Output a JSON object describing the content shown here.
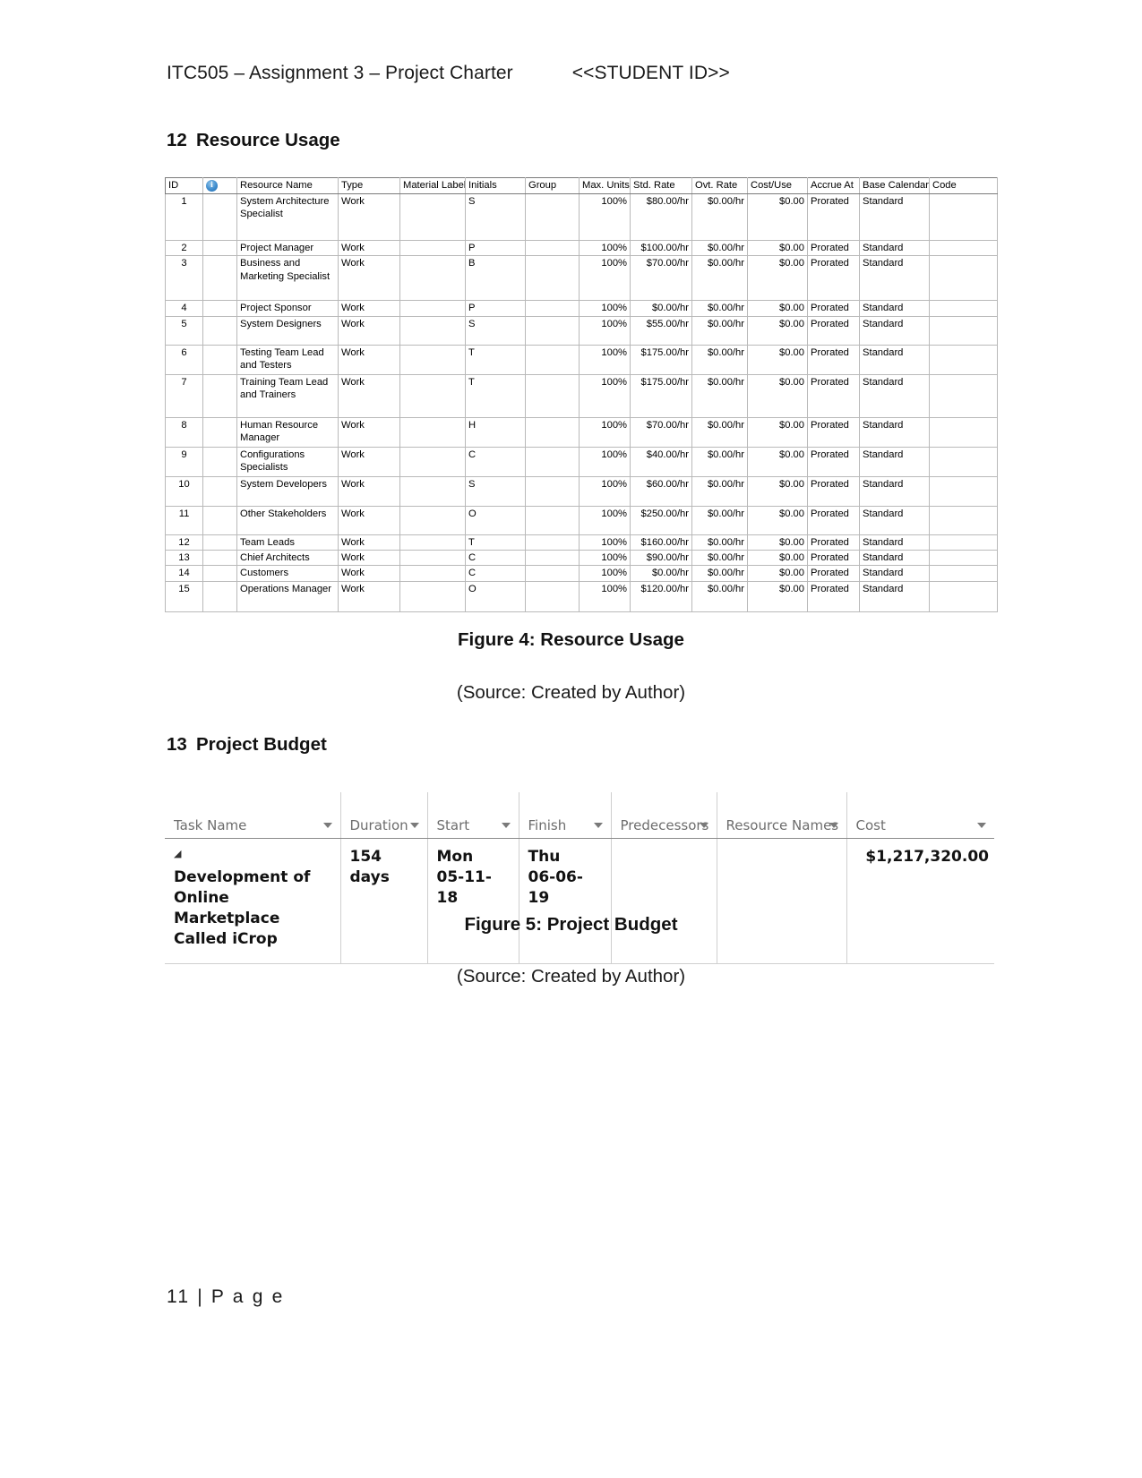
{
  "document": {
    "header_title": "ITC505 – Assignment 3 – Project Charter",
    "header_student_id": "<<STUDENT ID>>",
    "footer": "11 | P a g e"
  },
  "sections": [
    {
      "number": "12",
      "title": "Resource Usage"
    },
    {
      "number": "13",
      "title": "Project Budget"
    }
  ],
  "resource_usage": {
    "headers": {
      "id": "ID",
      "indicator": "i",
      "resource_name": "Resource Name",
      "type": "Type",
      "material_label": "Material Label",
      "initials": "Initials",
      "group": "Group",
      "max_units": "Max. Units",
      "std_rate": "Std. Rate",
      "ovt_rate": "Ovt. Rate",
      "cost_use": "Cost/Use",
      "accrue_at": "Accrue At",
      "base_calendar": "Base Calendar",
      "code": "Code"
    },
    "rows": [
      {
        "id": "1",
        "name": "System Architecture Specialist",
        "type": "Work",
        "material_label": "",
        "initials": "S",
        "group": "",
        "max_units": "100%",
        "std_rate": "$80.00/hr",
        "ovt_rate": "$0.00/hr",
        "cost_use": "$0.00",
        "accrue_at": "Prorated",
        "base_calendar": "Standard",
        "code": ""
      },
      {
        "id": "2",
        "name": "Project Manager",
        "type": "Work",
        "material_label": "",
        "initials": "P",
        "group": "",
        "max_units": "100%",
        "std_rate": "$100.00/hr",
        "ovt_rate": "$0.00/hr",
        "cost_use": "$0.00",
        "accrue_at": "Prorated",
        "base_calendar": "Standard",
        "code": ""
      },
      {
        "id": "3",
        "name": "Business and Marketing Specialist",
        "type": "Work",
        "material_label": "",
        "initials": "B",
        "group": "",
        "max_units": "100%",
        "std_rate": "$70.00/hr",
        "ovt_rate": "$0.00/hr",
        "cost_use": "$0.00",
        "accrue_at": "Prorated",
        "base_calendar": "Standard",
        "code": ""
      },
      {
        "id": "4",
        "name": "Project Sponsor",
        "type": "Work",
        "material_label": "",
        "initials": "P",
        "group": "",
        "max_units": "100%",
        "std_rate": "$0.00/hr",
        "ovt_rate": "$0.00/hr",
        "cost_use": "$0.00",
        "accrue_at": "Prorated",
        "base_calendar": "Standard",
        "code": ""
      },
      {
        "id": "5",
        "name": "System Designers",
        "type": "Work",
        "material_label": "",
        "initials": "S",
        "group": "",
        "max_units": "100%",
        "std_rate": "$55.00/hr",
        "ovt_rate": "$0.00/hr",
        "cost_use": "$0.00",
        "accrue_at": "Prorated",
        "base_calendar": "Standard",
        "code": ""
      },
      {
        "id": "6",
        "name": "Testing Team Lead and Testers",
        "type": "Work",
        "material_label": "",
        "initials": "T",
        "group": "",
        "max_units": "100%",
        "std_rate": "$175.00/hr",
        "ovt_rate": "$0.00/hr",
        "cost_use": "$0.00",
        "accrue_at": "Prorated",
        "base_calendar": "Standard",
        "code": ""
      },
      {
        "id": "7",
        "name": "Training Team Lead and Trainers",
        "type": "Work",
        "material_label": "",
        "initials": "T",
        "group": "",
        "max_units": "100%",
        "std_rate": "$175.00/hr",
        "ovt_rate": "$0.00/hr",
        "cost_use": "$0.00",
        "accrue_at": "Prorated",
        "base_calendar": "Standard",
        "code": ""
      },
      {
        "id": "8",
        "name": "Human Resource Manager",
        "type": "Work",
        "material_label": "",
        "initials": "H",
        "group": "",
        "max_units": "100%",
        "std_rate": "$70.00/hr",
        "ovt_rate": "$0.00/hr",
        "cost_use": "$0.00",
        "accrue_at": "Prorated",
        "base_calendar": "Standard",
        "code": ""
      },
      {
        "id": "9",
        "name": "Configurations Specialists",
        "type": "Work",
        "material_label": "",
        "initials": "C",
        "group": "",
        "max_units": "100%",
        "std_rate": "$40.00/hr",
        "ovt_rate": "$0.00/hr",
        "cost_use": "$0.00",
        "accrue_at": "Prorated",
        "base_calendar": "Standard",
        "code": ""
      },
      {
        "id": "10",
        "name": "System Developers",
        "type": "Work",
        "material_label": "",
        "initials": "S",
        "group": "",
        "max_units": "100%",
        "std_rate": "$60.00/hr",
        "ovt_rate": "$0.00/hr",
        "cost_use": "$0.00",
        "accrue_at": "Prorated",
        "base_calendar": "Standard",
        "code": ""
      },
      {
        "id": "11",
        "name": "Other Stakeholders",
        "type": "Work",
        "material_label": "",
        "initials": "O",
        "group": "",
        "max_units": "100%",
        "std_rate": "$250.00/hr",
        "ovt_rate": "$0.00/hr",
        "cost_use": "$0.00",
        "accrue_at": "Prorated",
        "base_calendar": "Standard",
        "code": ""
      },
      {
        "id": "12",
        "name": "Team Leads",
        "type": "Work",
        "material_label": "",
        "initials": "T",
        "group": "",
        "max_units": "100%",
        "std_rate": "$160.00/hr",
        "ovt_rate": "$0.00/hr",
        "cost_use": "$0.00",
        "accrue_at": "Prorated",
        "base_calendar": "Standard",
        "code": ""
      },
      {
        "id": "13",
        "name": "Chief Architects",
        "type": "Work",
        "material_label": "",
        "initials": "C",
        "group": "",
        "max_units": "100%",
        "std_rate": "$90.00/hr",
        "ovt_rate": "$0.00/hr",
        "cost_use": "$0.00",
        "accrue_at": "Prorated",
        "base_calendar": "Standard",
        "code": ""
      },
      {
        "id": "14",
        "name": "Customers",
        "type": "Work",
        "material_label": "",
        "initials": "C",
        "group": "",
        "max_units": "100%",
        "std_rate": "$0.00/hr",
        "ovt_rate": "$0.00/hr",
        "cost_use": "$0.00",
        "accrue_at": "Prorated",
        "base_calendar": "Standard",
        "code": ""
      },
      {
        "id": "15",
        "name": "Operations Manager",
        "type": "Work",
        "material_label": "",
        "initials": "O",
        "group": "",
        "max_units": "100%",
        "std_rate": "$120.00/hr",
        "ovt_rate": "$0.00/hr",
        "cost_use": "$0.00",
        "accrue_at": "Prorated",
        "base_calendar": "Standard",
        "code": ""
      }
    ]
  },
  "figure4": {
    "caption": "Figure 4: Resource Usage",
    "source": "(Source: Created by Author)"
  },
  "project_budget": {
    "headers": {
      "task_name": "Task Name",
      "duration": "Duration",
      "start": "Start",
      "finish": "Finish",
      "predecessors": "Predecessors",
      "resource_names": "Resource Names",
      "cost": "Cost"
    },
    "rows": [
      {
        "collapse": "◢",
        "task_name": "Development of Online Marketplace Called iCrop",
        "duration": "154 days",
        "start_day": "Mon",
        "start_date": "05-11-18",
        "finish_day": "Thu",
        "finish_date": "06-06-19",
        "predecessors": "",
        "resource_names": "",
        "cost": "$1,217,320.00"
      }
    ]
  },
  "figure5": {
    "caption": "Figure 5: Project Budget",
    "source": "(Source: Created by Author)"
  }
}
